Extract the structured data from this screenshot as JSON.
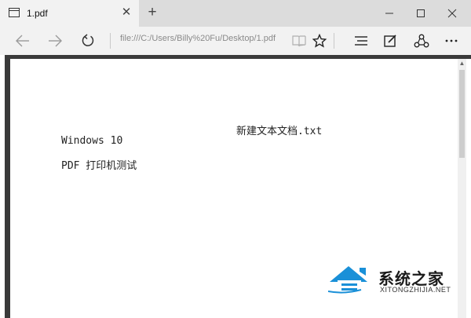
{
  "tab": {
    "title": "1.pdf",
    "close_glyph": "✕",
    "new_tab_glyph": "+"
  },
  "window_controls": {
    "minimize": "minimize-icon",
    "maximize": "maximize-icon",
    "close": "close-icon"
  },
  "navbar": {
    "address": "file:///C:/Users/Billy%20Fu/Desktop/1.pdf",
    "icons": [
      "back-arrow-icon",
      "forward-arrow-icon",
      "refresh-icon",
      "reading-view-icon",
      "favorite-star-icon",
      "hub-icon",
      "web-note-icon",
      "share-icon",
      "more-icon"
    ]
  },
  "document": {
    "header": "新建文本文档.txt",
    "lines": [
      "Windows 10",
      "PDF 打印机测试"
    ]
  },
  "watermark": {
    "title": "系统之家",
    "site": "XITONGZHIJIA.NET",
    "brand_color": "#1a90d8"
  }
}
